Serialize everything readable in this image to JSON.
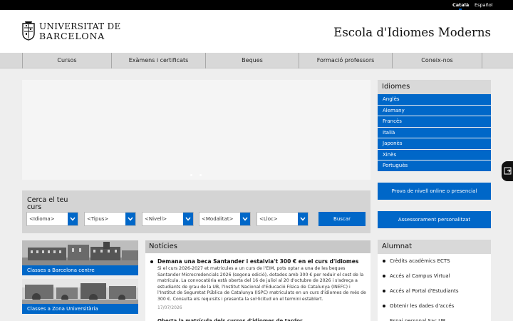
{
  "lang_switch": {
    "active": "Català",
    "other": "Español"
  },
  "header": {
    "logo_line1": "UNIVERSITAT DE",
    "logo_line2": "BARCELONA",
    "site_title": "Escola d'Idiomes Moderns"
  },
  "nav": {
    "items": [
      "Cursos",
      "Exàmens i certificats",
      "Beques",
      "Formació professors",
      "Coneix-nos"
    ]
  },
  "idiomes": {
    "title": "Idiomes",
    "items": [
      "Anglès",
      "Alemany",
      "Francès",
      "Italià",
      "Japonès",
      "Xinès",
      "Portuguès"
    ]
  },
  "search": {
    "title": "Cerca el teu curs",
    "selects": [
      "<Idioma>",
      "<Tipus>",
      "<Nivell>",
      "<Modalitat>",
      "<Lloc>"
    ],
    "button": "Buscar"
  },
  "buttons": {
    "prova": "Prova de nivell online o presencial",
    "assessorament": "Assessorament personalitzat"
  },
  "photos": [
    {
      "caption": "Classes a Barcelona centre"
    },
    {
      "caption": "Classes a Zona Universitària"
    }
  ],
  "news": {
    "title": "Notícies",
    "item": {
      "headline": "Demana una beca Santander i estalvia't 300 € en el curs d'idiomes",
      "body": "Si el curs 2026-2027 et matricules a un curs de l'EIM, pots optar a una de les beques Santander Microcredencials 2026 (segona edició), dotades amb 300 € per reduir el cost de la matrícula. La convocatòria està oberta del 16 de juliol al 20 d'octubre de 2026 i s'adreça a estudiants de grau de la UB, l'Institut Nacional d'Educació Física de Catalunya (INEFC) i l'Institut de Seguretat Pública de Catalunya (ISPC) matriculats en un curs d'idiomes de més de 300 €. Consulta els requisits i presenta la sol·licitud en el termini establert.",
      "date": "17/07/2026"
    },
    "next_headline": "Oberta la matrícula dels cursos d'idiomes de tardor"
  },
  "alumnat": {
    "title": "Alumnat",
    "items": [
      "Crèdits acadèmics ECTS",
      "Accés al Campus Virtual",
      "Accés al Portal d'Estudiants",
      "Obtenir les dades d'accés",
      "Espai personal Sac UB"
    ]
  },
  "colors": {
    "accent": "#0067c8",
    "nav_bg": "#d8d8d8",
    "panel_head": "#d9d9d9"
  }
}
